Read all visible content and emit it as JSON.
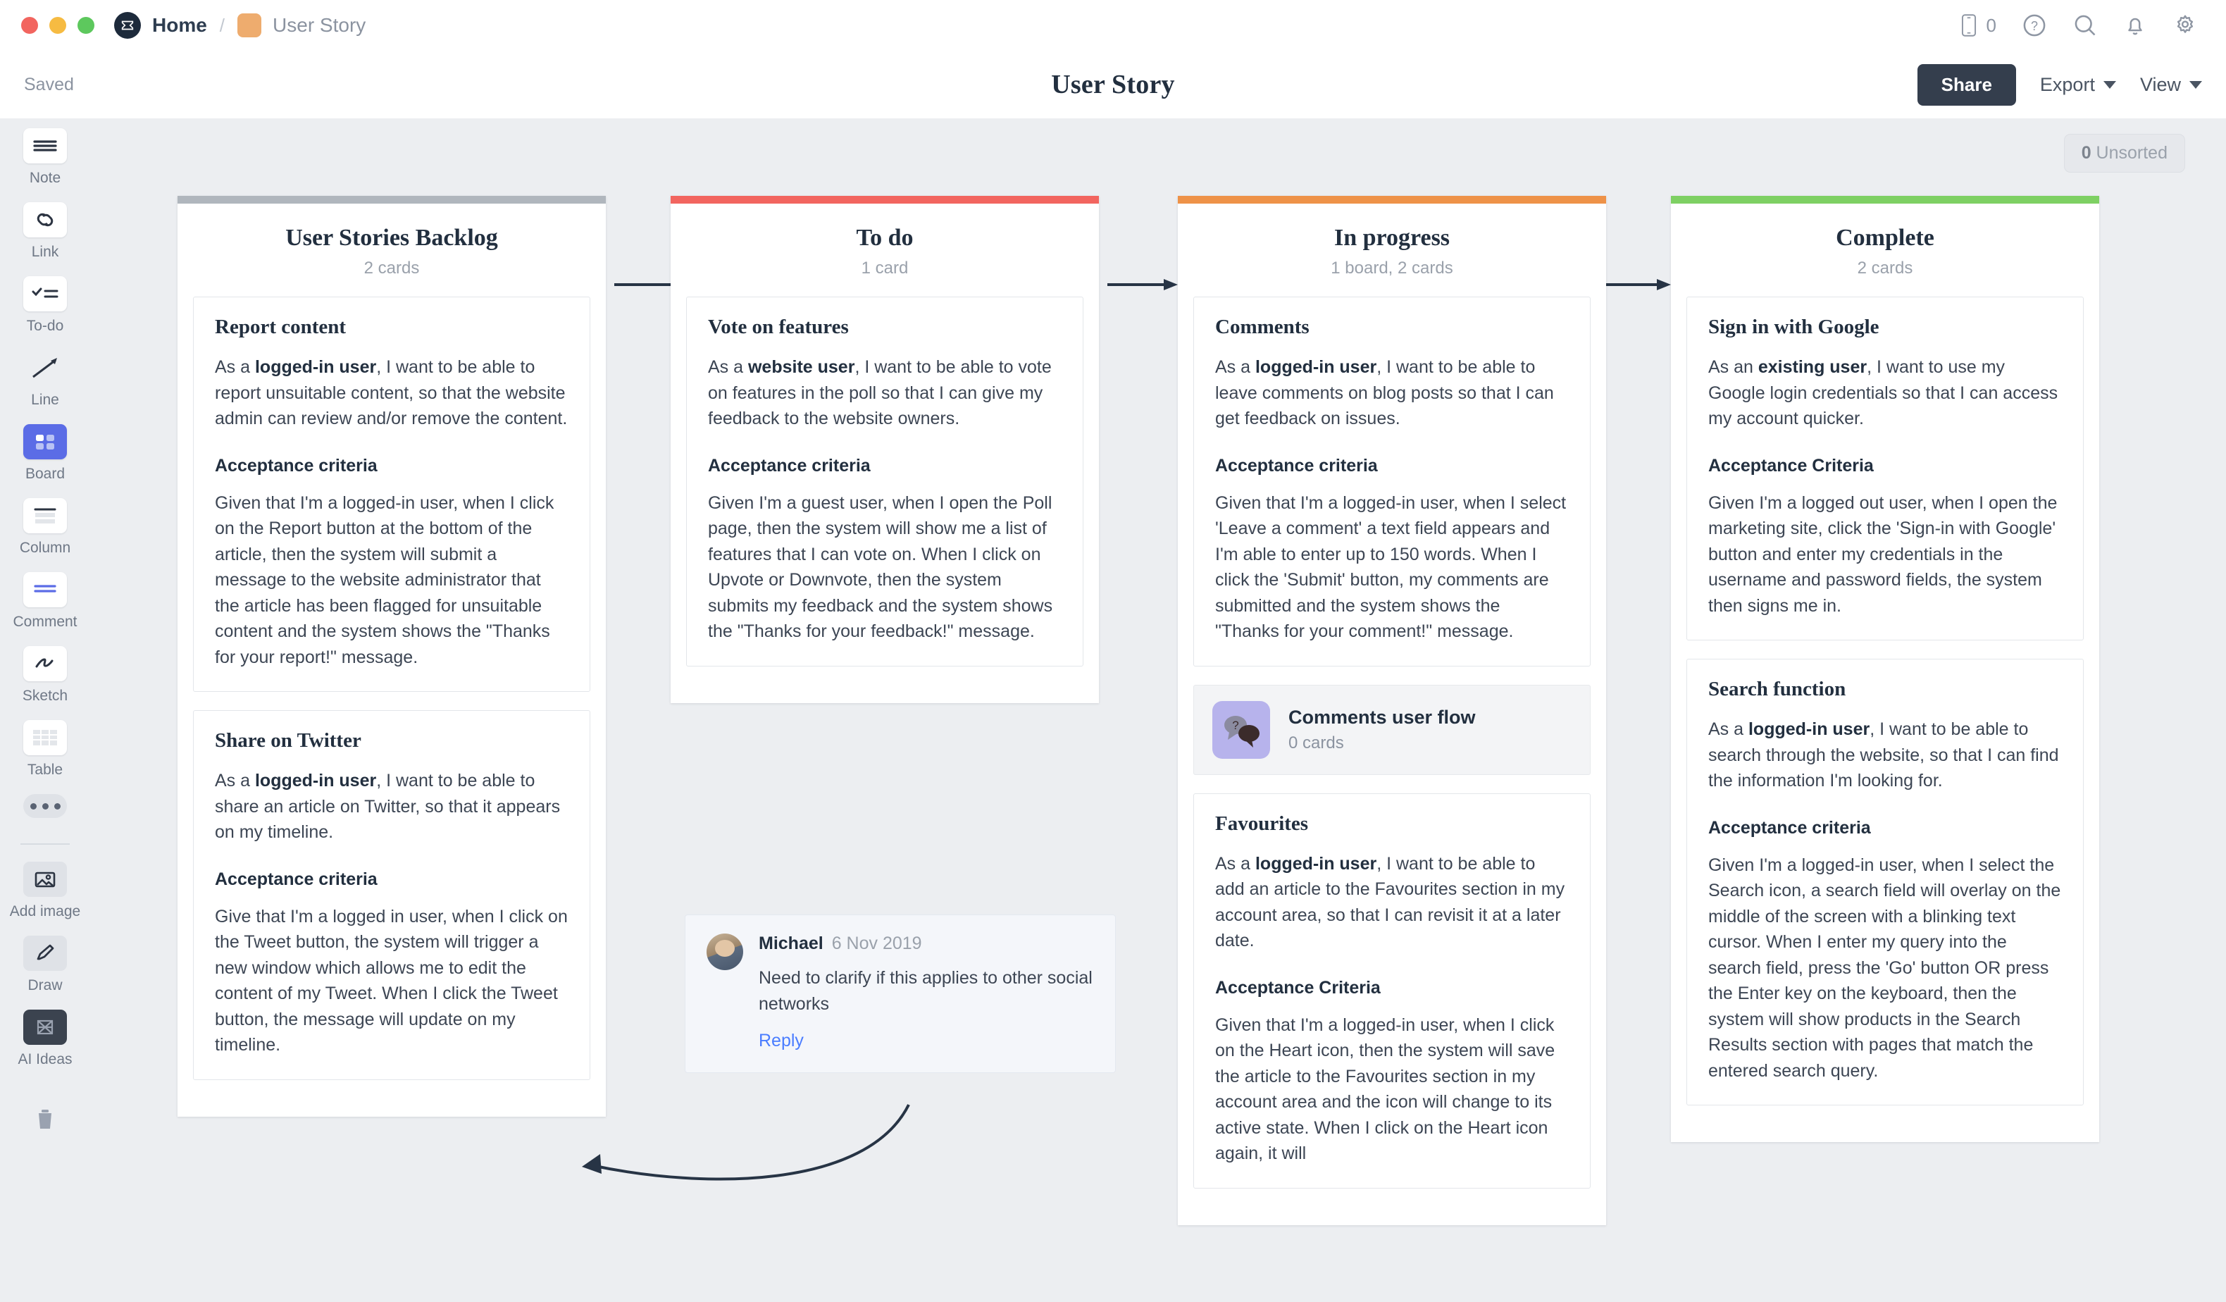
{
  "titlebar": {
    "home_label": "Home",
    "separator": "/",
    "doc_name": "User Story",
    "device_count": "0",
    "icons": [
      "device-icon",
      "help-icon",
      "search-icon",
      "bell-icon",
      "gear-icon"
    ]
  },
  "subheader": {
    "saved_label": "Saved",
    "title": "User Story",
    "share_label": "Share",
    "export_label": "Export",
    "view_label": "View"
  },
  "toolbar": {
    "items": [
      {
        "label": "Note",
        "icon": "note-icon"
      },
      {
        "label": "Link",
        "icon": "link-icon"
      },
      {
        "label": "To-do",
        "icon": "todo-icon"
      },
      {
        "label": "Line",
        "icon": "line-icon"
      },
      {
        "label": "Board",
        "icon": "board-icon"
      },
      {
        "label": "Column",
        "icon": "column-icon"
      },
      {
        "label": "Comment",
        "icon": "comment-icon"
      },
      {
        "label": "Sketch",
        "icon": "sketch-icon"
      },
      {
        "label": "Table",
        "icon": "table-icon"
      },
      {
        "label": "Add image",
        "icon": "image-icon"
      },
      {
        "label": "Draw",
        "icon": "pencil-icon"
      },
      {
        "label": "AI Ideas",
        "icon": "ai-ideas-icon"
      }
    ],
    "more_icon": "more-icon",
    "trash_icon": "trash-icon"
  },
  "canvas": {
    "unsorted_count": "0",
    "unsorted_label": "Unsorted"
  },
  "board": {
    "accent_colors": {
      "backlog": "#b0b6bd",
      "todo": "#f2655f",
      "in_progress": "#ee9248",
      "complete": "#7ed063"
    },
    "columns": [
      {
        "id": "backlog",
        "title": "User Stories Backlog",
        "count": "2 cards",
        "accent": "#b0b6bd",
        "cards": [
          {
            "title": "Report content",
            "story_prefix": "As a ",
            "story_bold": "logged-in user",
            "story_rest": ", I want to be able to report unsuitable content, so that the website admin can review and/or remove the content.",
            "criteria_heading": "Acceptance criteria",
            "criteria_text": "Given that I'm a logged-in user, when I click on the Report button at the bottom of the article, then the system will submit a message to the website administrator that the article has been flagged for unsuitable content and the  system shows the \"Thanks for your report!\" message."
          },
          {
            "title": "Share on Twitter",
            "story_prefix": "As a ",
            "story_bold": "logged-in user",
            "story_rest": ", I want to be able to share an article on Twitter, so that it appears on my timeline.",
            "criteria_heading": "Acceptance criteria",
            "criteria_text": "Give that I'm a logged in user, when I click on the Tweet button, the system will trigger a new window which allows me to edit the content of my Tweet. When I click the Tweet button, the message will update on my timeline."
          }
        ]
      },
      {
        "id": "todo",
        "title": "To do",
        "count": "1 card",
        "accent": "#f2655f",
        "cards": [
          {
            "title": "Vote on features",
            "story_prefix": "As a ",
            "story_bold": "website user",
            "story_rest": ", I want to be able to vote on features in the poll so that I can give my feedback to the website owners.",
            "criteria_heading": "Acceptance criteria",
            "criteria_text": "Given I'm a guest user, when I open the Poll page, then the system will show me a list of features that I can vote on. When I click on Upvote or Downvote, then the system submits my feedback and the system shows the \"Thanks for your feedback!\" message."
          }
        ]
      },
      {
        "id": "in_progress",
        "title": "In progress",
        "count": "1 board, 2 cards",
        "accent": "#ee9248",
        "cards": [
          {
            "title": "Comments",
            "story_prefix": "As a ",
            "story_bold": "logged-in user",
            "story_rest": ", I want to be able to leave comments on blog posts so that I can get feedback on issues.",
            "criteria_heading": "Acceptance criteria",
            "criteria_text": "Given that I'm a logged-in user, when I select 'Leave a comment' a text field appears and I'm able to enter up to 150 words. When I click the 'Submit' button, my comments are submitted and the system shows the \"Thanks for your comment!\" message."
          }
        ],
        "board_tile": {
          "name": "Comments user flow",
          "count": "0 cards",
          "thumb_color": "#b7b3ec"
        },
        "cards_after": [
          {
            "title": "Favourites",
            "story_prefix": "As a ",
            "story_bold": "logged-in user",
            "story_rest": ", I want to be able to add an article to the Favourites section in my account area, so that I can revisit it at a later date.",
            "criteria_heading": "Acceptance Criteria",
            "criteria_text": "Given that I'm a logged-in user, when I click on the Heart icon, then the system will save the article to the Favourites section in my account area and the icon will change to its active state. When I click on the Heart icon again, it will"
          }
        ]
      },
      {
        "id": "complete",
        "title": "Complete",
        "count": "2 cards",
        "accent": "#7ed063",
        "cards": [
          {
            "title": "Sign in with Google",
            "story_prefix": "As an ",
            "story_bold": "existing user",
            "story_rest": ", I want to use my Google login credentials so that I can access my account quicker.",
            "criteria_heading": "Acceptance Criteria",
            "criteria_text": "Given I'm a logged out user, when I open the marketing site, click the 'Sign-in with Google' button and enter my credentials in the username and password fields, the system then signs me in."
          },
          {
            "title": "Search function",
            "story_prefix": "As a ",
            "story_bold": "logged-in user",
            "story_rest": ", I want to be able to search through the website, so that I can find the information I'm looking for.",
            "criteria_heading": "Acceptance criteria",
            "criteria_text": "Given I'm a logged-in user, when I select the Search icon, a search field will overlay on the middle of the screen with a blinking text cursor. When I enter my query into the search field, press the 'Go' button OR press the Enter key on the keyboard, then the system will show products in the Search Results section with pages that match the entered search query."
          }
        ]
      }
    ]
  },
  "comment": {
    "author": "Michael",
    "date": "6 Nov 2019",
    "body": "Need to clarify if this applies to other social networks",
    "reply_label": "Reply"
  }
}
